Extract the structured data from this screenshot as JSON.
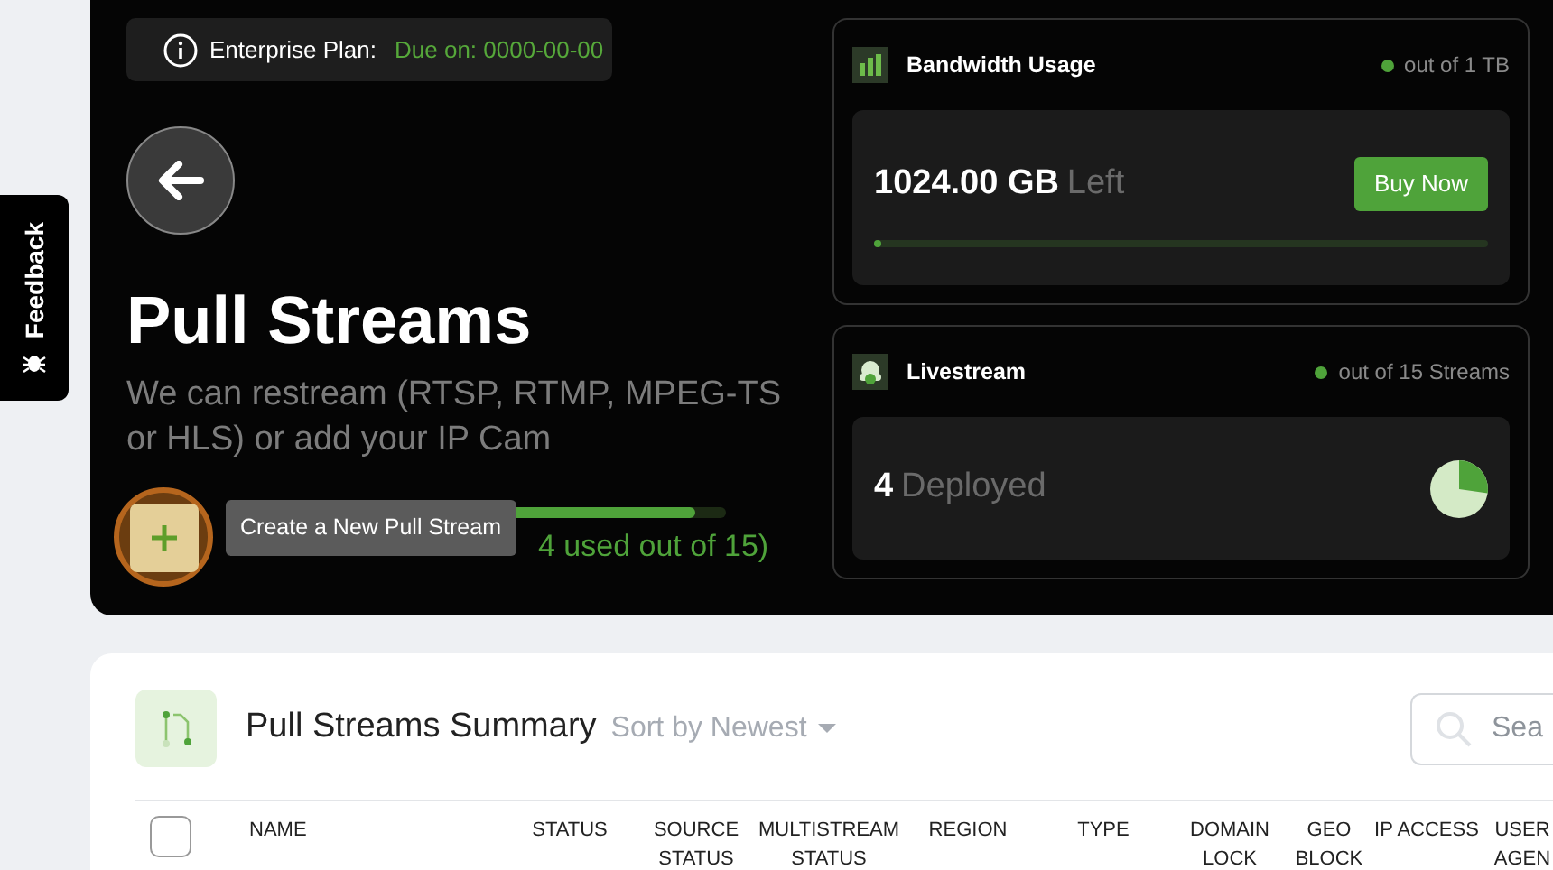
{
  "feedback_tab": {
    "label": "Feedback"
  },
  "plan": {
    "label": "Enterprise Plan:",
    "due": "Due on: 0000-00-00"
  },
  "page": {
    "title": "Pull Streams",
    "subtitle": "We can restream (RTSP, RTMP, MPEG-TS or HLS) or add your IP Cam"
  },
  "stream_usage": {
    "level": 0.93,
    "reading": "4 used out of 15)"
  },
  "tooltip": {
    "text": "Create a New Pull Stream"
  },
  "bandwidth": {
    "title": "Bandwidth Usage",
    "limit": "out of 1 TB",
    "amount": "1024.00 GB",
    "suffix": "Left",
    "button": "Buy Now",
    "level": 0.01
  },
  "livestream": {
    "title": "Livestream",
    "limit": "out of 15 Streams",
    "count": "4",
    "suffix": "Deployed"
  },
  "summary": {
    "title": "Pull Streams Summary",
    "sort": "Sort by Newest",
    "search_placeholder": "Sea",
    "select_all_checked": false,
    "columns": [
      "NAME",
      "STATUS",
      "SOURCE STATUS",
      "MULTISTREAM STATUS",
      "REGION",
      "TYPE",
      "DOMAIN LOCK",
      "GEO BLOCK",
      "IP ACCESS",
      "USER AGEN"
    ]
  }
}
